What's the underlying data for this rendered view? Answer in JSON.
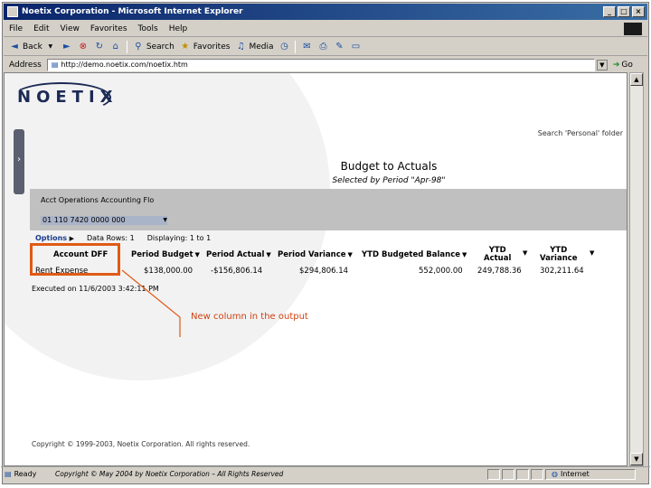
{
  "window": {
    "title": "Noetix Corporation - Microsoft Internet Explorer",
    "controls": [
      "_",
      "□",
      "×"
    ]
  },
  "menu": [
    "File",
    "Edit",
    "View",
    "Favorites",
    "Tools",
    "Help"
  ],
  "toolbar": {
    "back": "Back",
    "search": "Search",
    "favorites": "Favorites",
    "media": "Media"
  },
  "address": {
    "label": "Address",
    "url": "http://demo.noetix.com/noetix.htm",
    "go": "Go"
  },
  "page": {
    "logo": "NOETIX",
    "search_link": "Search 'Personal' folder",
    "report_title": "Budget to Actuals",
    "report_subtitle": "Selected by Period \"Apr-98\"",
    "param": {
      "label": "Acct Operations Accounting Flo",
      "value": "01 110 7420 0000 000"
    },
    "options": {
      "label": "Options",
      "data_rows": "Data Rows: 1",
      "displaying": "Displaying: 1 to 1"
    },
    "columns": {
      "account_dff": "Account DFF",
      "period_budget": "Period Budget",
      "period_actual": "Period Actual",
      "period_variance": "Period Variance",
      "ytd_budgeted_balance": "YTD Budgeted Balance",
      "ytd_actual_1": "YTD",
      "ytd_actual_2": "Actual",
      "ytd_variance_1": "YTD",
      "ytd_variance_2": "Variance"
    },
    "rows": [
      {
        "account": "Rent Expense",
        "period_budget": "$138,000.00",
        "period_actual": "-$156,806.14",
        "period_variance": "$294,806.14",
        "ytd_budgeted_balance": "552,000.00",
        "ytd_actual": "249,788.36",
        "ytd_variance": "302,211.64"
      }
    ],
    "executed": "Executed on 11/6/2003 3:42:11 PM",
    "annotation": "New column in the output",
    "copyright": "Copyright © 1999-2003, Noetix Corporation. All rights reserved."
  },
  "status": {
    "ready": "Ready",
    "note": "Copyright © May 2004 by Noetix Corporation – All Rights Reserved",
    "zone": "Internet"
  },
  "colors": {
    "highlight": "#e05a14",
    "title_bar": "#0a246a",
    "param_band": "#c0c0c0"
  }
}
